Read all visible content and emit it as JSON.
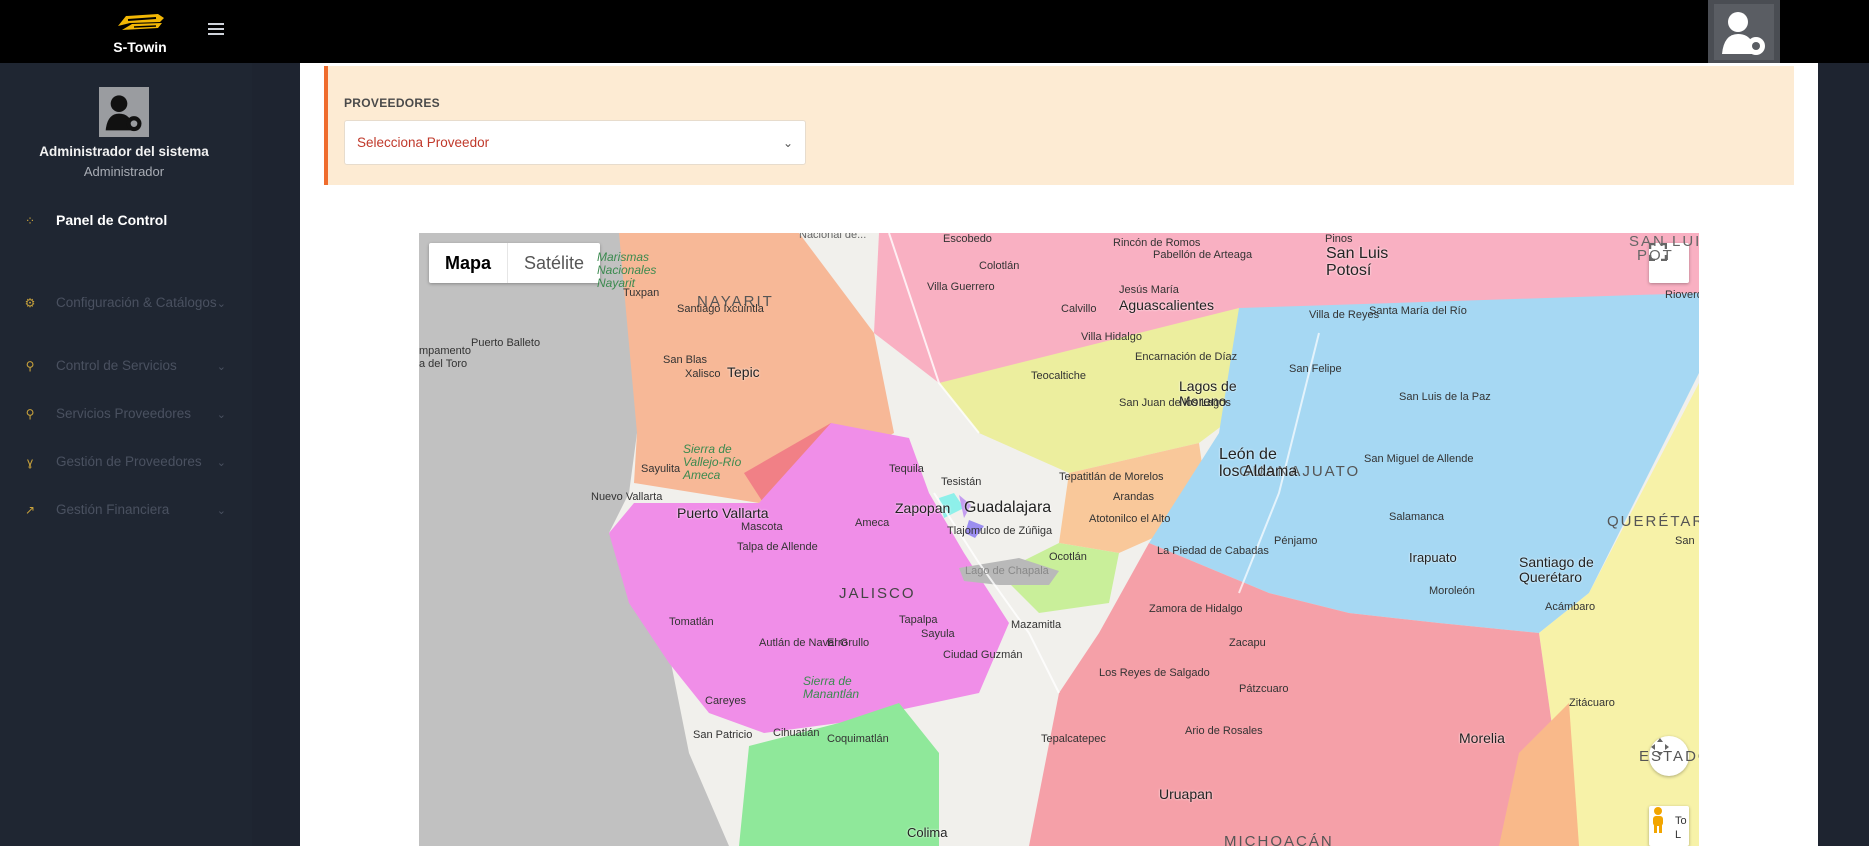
{
  "app": {
    "brand": "S-Towin"
  },
  "sidebar": {
    "user_name": "Administrador del sistema",
    "user_role": "Administrador",
    "items": [
      {
        "label": "Panel de Control",
        "icon": "dashboard-icon",
        "active": true
      },
      {
        "label": "Configuración & Catálogos",
        "icon": "gear-icon",
        "active": false
      },
      {
        "label": "Control de Servicios",
        "icon": "services-icon",
        "active": false
      },
      {
        "label": "Servicios Proveedores",
        "icon": "providers-icon",
        "active": false
      },
      {
        "label": "Gestión de Proveedores",
        "icon": "key-icon",
        "active": false
      },
      {
        "label": "Gestión Financiera",
        "icon": "chart-icon",
        "active": false
      }
    ]
  },
  "providers": {
    "label": "PROVEEDORES",
    "selected": "Selecciona Proveedor"
  },
  "map": {
    "type_buttons": [
      "Mapa",
      "Satélite"
    ],
    "active_type": "Mapa",
    "states": [
      "NAYARIT",
      "JALISCO",
      "GUANAJUATO",
      "QUERÉTARO",
      "MICHOACÁN",
      "ESTADO"
    ],
    "big_cities": [
      "Guadalajara",
      "Puerto Vallarta",
      "Tepic",
      "Zapopan",
      "Aguascalientes",
      "León de los Aldama",
      "San Luis Potosí",
      "Morelia",
      "Santiago de Querétaro",
      "Uruapan",
      "Irapuato",
      "Lagos de Moreno",
      "Colima"
    ],
    "small_cities": [
      "Escobedo",
      "Colotlán",
      "Villa Guerrero",
      "Calvillo",
      "Pabellón de Arteaga",
      "Rincón de Romos",
      "Jesús María",
      "Villa Hidalgo",
      "Encarnación de Díaz",
      "Teocaltiche",
      "San Juan de los Lagos",
      "Villa de Reyes",
      "Santa María del Río",
      "San Felipe",
      "San Luis de la Paz",
      "San Miguel de Allende",
      "Tequila",
      "Tesistán",
      "Arandas",
      "Atotonilco el Alto",
      "Tepatitlán de Morelos",
      "Ocotlán",
      "Tlajomulco de Zúñiga",
      "Ameca",
      "Mascota",
      "Talpa de Allende",
      "Tomatlán",
      "Autlán de Navarro",
      "El Grullo",
      "Tapalpa",
      "Sayula",
      "Ciudad Guzmán",
      "Mazamitla",
      "Zamora de Hidalgo",
      "Zacapu",
      "Pátzcuaro",
      "Los Reyes de Salgado",
      "Moroleón",
      "Acámbaro",
      "La Piedad de Cabadas",
      "Pénjamo",
      "Salamanca",
      "Zitácuaro",
      "Santiago Ixcuintla",
      "San Blas",
      "Xalisco",
      "Tuxpan",
      "Sayulita",
      "Nuevo Vallarta",
      "Puerto Balleto",
      "Careyes",
      "San Patricio",
      "Cihuatlán",
      "Coquimatlán",
      "Tepalcatepec",
      "Ario de Rosales",
      "Pinos",
      "Rioverde",
      "Lago de Chapala"
    ],
    "nature_labels": [
      "Marismas Nacionales Nayarit",
      "Sierra de Vallejo-Río Ameca",
      "Sierra de Manantlán"
    ],
    "edge_labels": [
      "Nacional de...",
      "mpamento",
      "a del Toro",
      "SAN LUIS",
      "POT",
      "San",
      "To",
      "L"
    ],
    "colors": {
      "nayarit": "#f7b897",
      "jalisco": "#f08ee8",
      "zac_ags": "#f9b0c2",
      "guanajuato": "#a6d8f3",
      "michoacan": "#f5a0a8",
      "qro": "#f7f2a8"
    }
  }
}
